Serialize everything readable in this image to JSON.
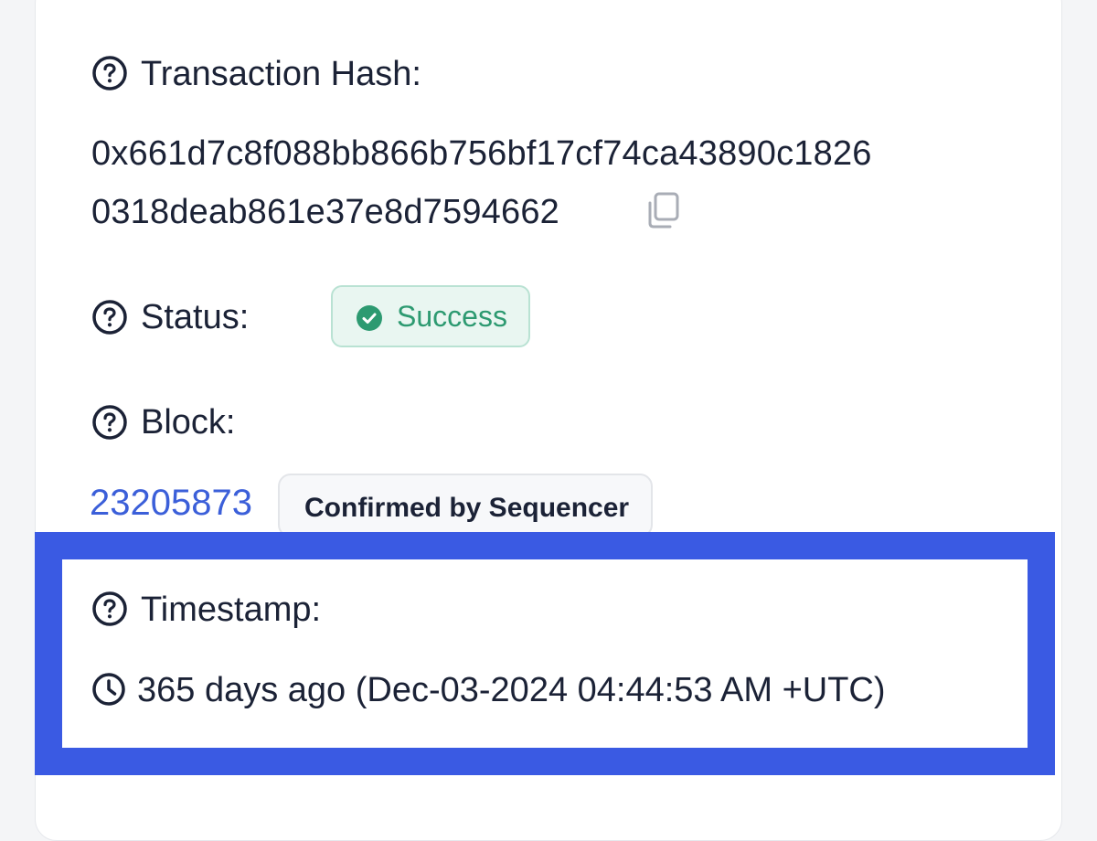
{
  "transaction_hash": {
    "label": "Transaction Hash:",
    "line1": "0x661d7c8f088bb866b756bf17cf74ca43890c1826",
    "line2": "0318deab861e37e8d7594662",
    "copy_icon": "copy-icon",
    "help_icon": "question-circle-icon"
  },
  "status": {
    "label": "Status:",
    "value": "Success",
    "badge_icon": "check-circle-icon",
    "color": "#2d9a71",
    "help_icon": "question-circle-icon"
  },
  "block": {
    "label": "Block:",
    "number": "23205873",
    "confirmation": "Confirmed by Sequencer",
    "link_color": "#3b5fd9",
    "help_icon": "question-circle-icon"
  },
  "timestamp": {
    "label": "Timestamp:",
    "value": "365 days ago (Dec-03-2024 04:44:53 AM +UTC)",
    "clock_icon": "clock-icon",
    "help_icon": "question-circle-icon",
    "highlight_color": "#3a5ae3"
  }
}
